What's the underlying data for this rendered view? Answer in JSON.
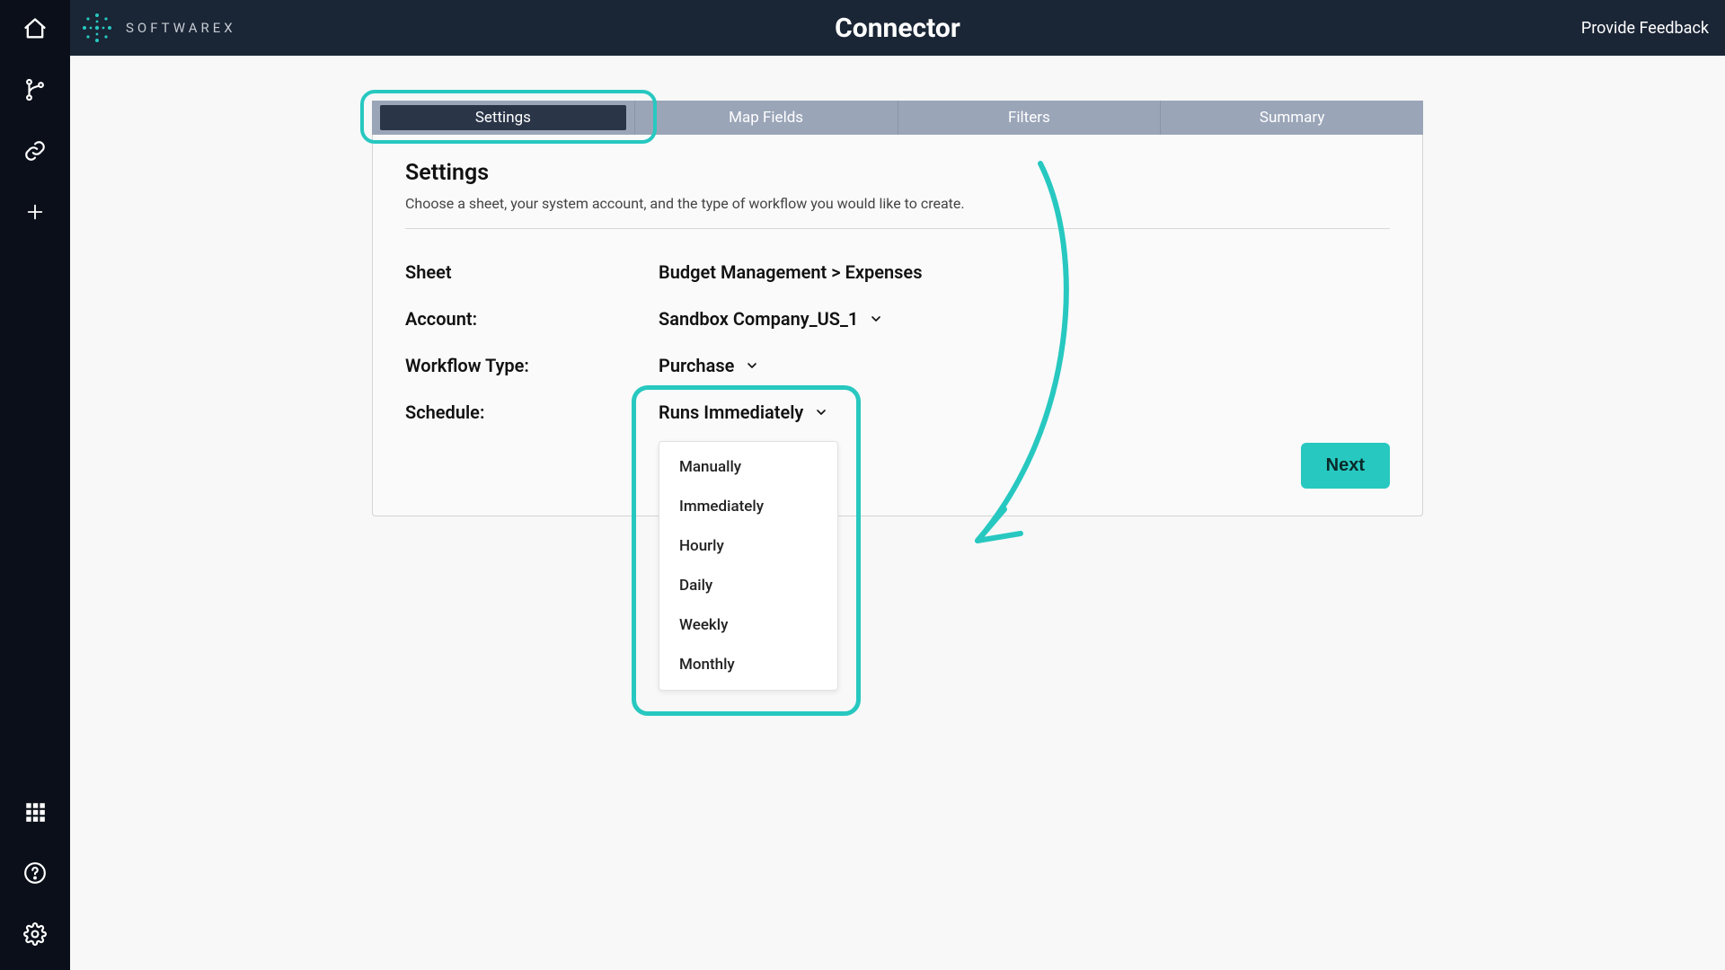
{
  "brand": {
    "name": "SOFTWAREX"
  },
  "topbar": {
    "title": "Connector",
    "feedback": "Provide Feedback"
  },
  "sidebar": {
    "top_icons": [
      "home",
      "branch",
      "link",
      "plus"
    ],
    "bottom_icons": [
      "apps",
      "help",
      "settings"
    ]
  },
  "tabs": {
    "items": [
      {
        "label": "Settings",
        "active": true
      },
      {
        "label": "Map Fields",
        "active": false
      },
      {
        "label": "Filters",
        "active": false
      },
      {
        "label": "Summary",
        "active": false
      }
    ]
  },
  "panel": {
    "title": "Settings",
    "description": "Choose a sheet, your system account, and the type of workflow you would like to create."
  },
  "form": {
    "sheet": {
      "label": "Sheet",
      "value": "Budget Management > Expenses"
    },
    "account": {
      "label": "Account:",
      "value": "Sandbox Company_US_1"
    },
    "workflow": {
      "label": "Workflow Type:",
      "value": "Purchase"
    },
    "schedule": {
      "label": "Schedule:",
      "value": "Runs Immediately",
      "options": [
        "Manually",
        "Immediately",
        "Hourly",
        "Daily",
        "Weekly",
        "Monthly"
      ]
    }
  },
  "actions": {
    "next": "Next"
  },
  "colors": {
    "accent": "#27c8c0",
    "header": "#1a2535",
    "sidebar": "#0a0f1a"
  }
}
